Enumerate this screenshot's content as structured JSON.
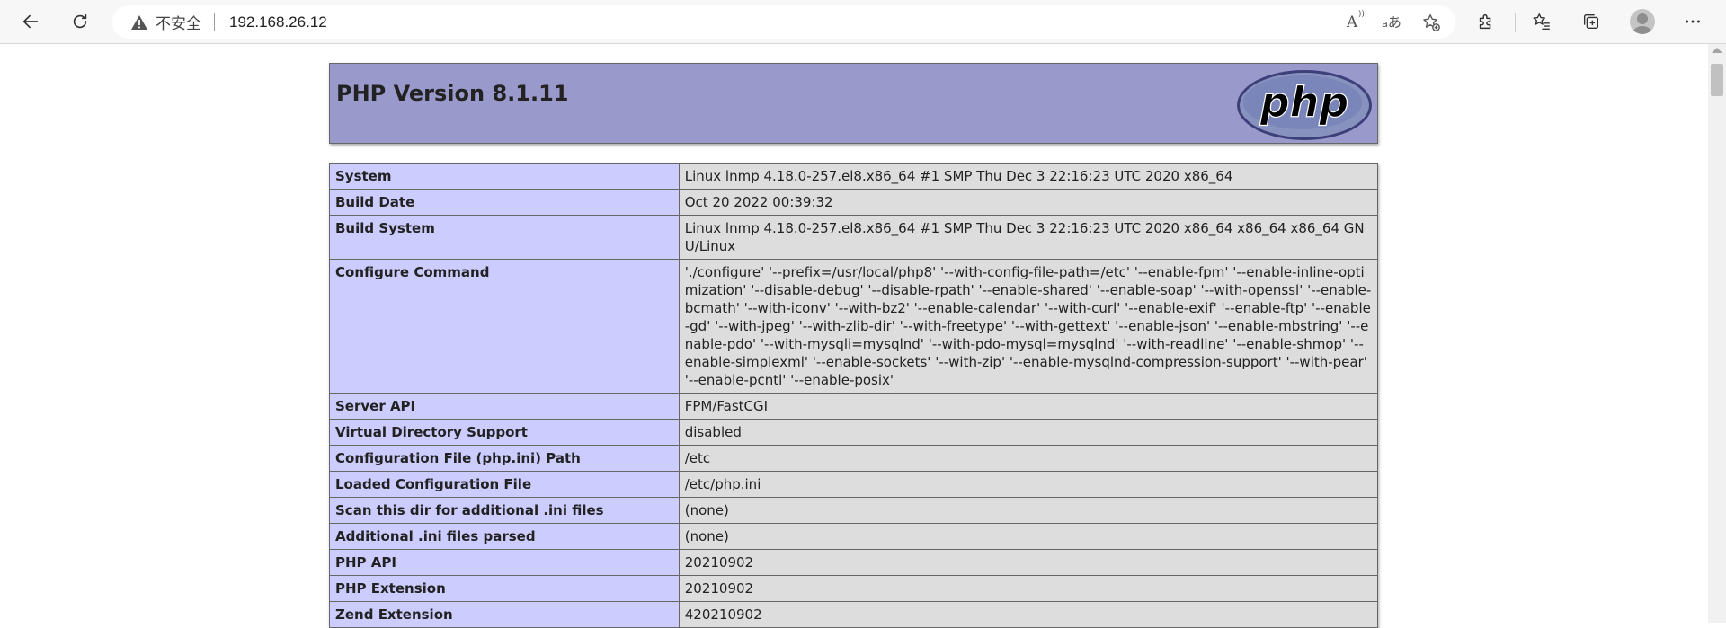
{
  "browser": {
    "insecure_label": "不安全",
    "url": "192.168.26.12",
    "read_aloud_glyph": "A",
    "translate_glyph": "あ"
  },
  "page": {
    "title": "PHP Version 8.1.11",
    "logo_text": "php",
    "rows": [
      {
        "key": "System",
        "value": "Linux lnmp 4.18.0-257.el8.x86_64 #1 SMP Thu Dec 3 22:16:23 UTC 2020 x86_64"
      },
      {
        "key": "Build Date",
        "value": "Oct 20 2022 00:39:32"
      },
      {
        "key": "Build System",
        "value": "Linux lnmp 4.18.0-257.el8.x86_64 #1 SMP Thu Dec 3 22:16:23 UTC 2020 x86_64 x86_64 x86_64 GNU/Linux"
      },
      {
        "key": "Configure Command",
        "value": "'./configure' '--prefix=/usr/local/php8' '--with-config-file-path=/etc' '--enable-fpm' '--enable-inline-optimization' '--disable-debug' '--disable-rpath' '--enable-shared' '--enable-soap' '--with-openssl' '--enable-bcmath' '--with-iconv' '--with-bz2' '--enable-calendar' '--with-curl' '--enable-exif' '--enable-ftp' '--enable-gd' '--with-jpeg' '--with-zlib-dir' '--with-freetype' '--with-gettext' '--enable-json' '--enable-mbstring' '--enable-pdo' '--with-mysqli=mysqlnd' '--with-pdo-mysql=mysqlnd' '--with-readline' '--enable-shmop' '--enable-simplexml' '--enable-sockets' '--with-zip' '--enable-mysqlnd-compression-support' '--with-pear' '--enable-pcntl' '--enable-posix'"
      },
      {
        "key": "Server API",
        "value": "FPM/FastCGI"
      },
      {
        "key": "Virtual Directory Support",
        "value": "disabled"
      },
      {
        "key": "Configuration File (php.ini) Path",
        "value": "/etc"
      },
      {
        "key": "Loaded Configuration File",
        "value": "/etc/php.ini"
      },
      {
        "key": "Scan this dir for additional .ini files",
        "value": "(none)"
      },
      {
        "key": "Additional .ini files parsed",
        "value": "(none)"
      },
      {
        "key": "PHP API",
        "value": "20210902"
      },
      {
        "key": "PHP Extension",
        "value": "20210902"
      },
      {
        "key": "Zend Extension",
        "value": "420210902"
      }
    ]
  }
}
